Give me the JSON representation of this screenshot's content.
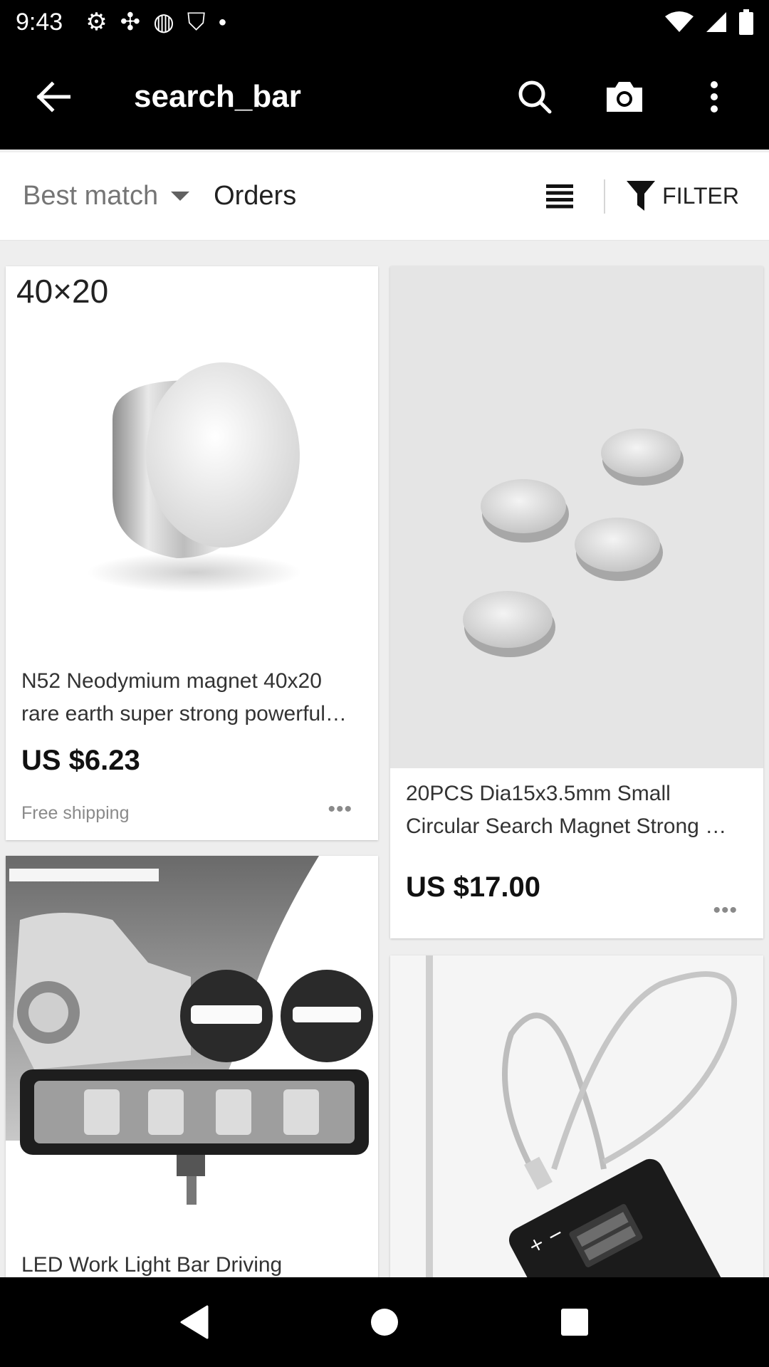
{
  "status_bar": {
    "time": "9:43",
    "icons": [
      "settings-icon",
      "fan-icon",
      "sync-icon",
      "play-shield-icon",
      "dot-icon",
      "wifi-icon",
      "signal-icon",
      "battery-icon"
    ]
  },
  "app_bar": {
    "title": "search_bar",
    "actions": [
      "search-icon",
      "camera-icon",
      "overflow-menu-icon"
    ]
  },
  "sort_bar": {
    "best_match": "Best match",
    "orders": "Orders",
    "filter": "FILTER"
  },
  "products": [
    {
      "image_text": "40×20",
      "title": "N52 Neodymium magnet 40x20 rare earth super strong powerful…",
      "price": "US $6.23",
      "shipping": "Free shipping"
    },
    {
      "title": "20PCS Dia15x3.5mm Small Circular Search Magnet Strong …",
      "price": "US $17.00"
    },
    {
      "title": "LED Work Light Bar Driving"
    },
    {
      "title": ""
    }
  ],
  "colors": {
    "bars": "#000000",
    "page_bg": "#eeeeee",
    "card_bg": "#ffffff",
    "muted_text": "#757575"
  }
}
